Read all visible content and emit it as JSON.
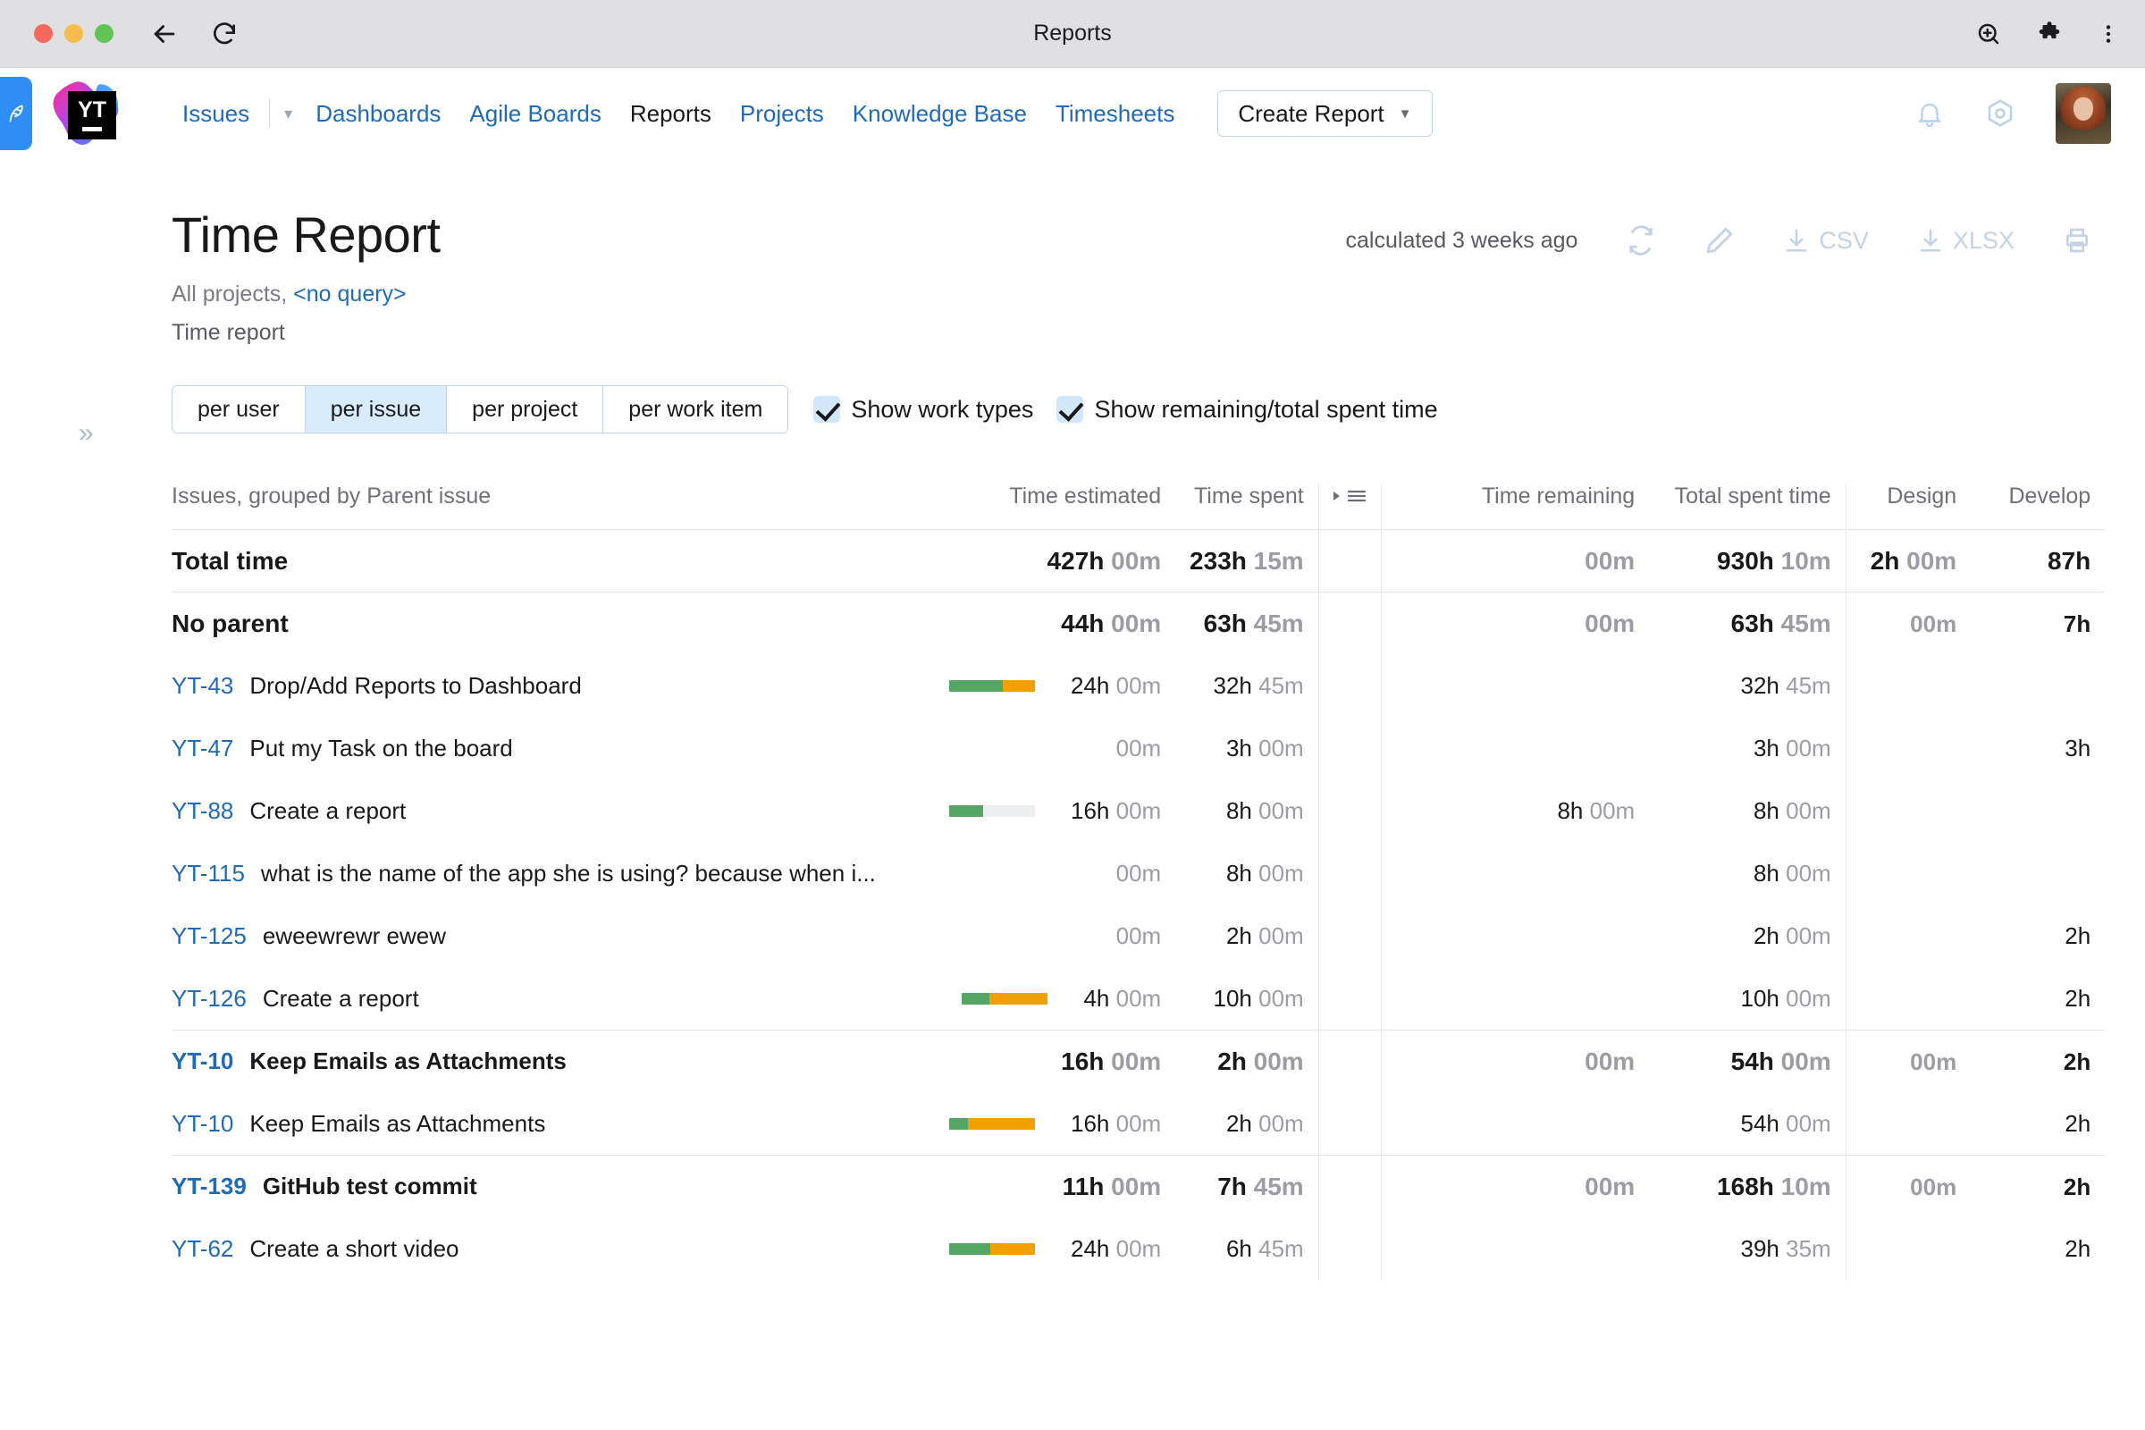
{
  "browser": {
    "tab_title": "Reports",
    "icons": [
      "back-arrow-icon",
      "reload-icon",
      "zoom-icon",
      "extensions-icon",
      "browser-menu-icon"
    ]
  },
  "app_nav": {
    "logo": "youtrack-logo",
    "badge_text": "YT",
    "links": [
      {
        "label": "Issues",
        "active": false,
        "has_chevron": true
      },
      {
        "label": "Dashboards",
        "active": false
      },
      {
        "label": "Agile Boards",
        "active": false
      },
      {
        "label": "Reports",
        "active": true
      },
      {
        "label": "Projects",
        "active": false
      },
      {
        "label": "Knowledge Base",
        "active": false
      },
      {
        "label": "Timesheets",
        "active": false
      }
    ],
    "create_report_label": "Create Report",
    "right_icons": [
      "bell-icon",
      "settings-hex-icon",
      "avatar"
    ]
  },
  "header": {
    "title": "Time Report",
    "subtitle_prefix": "All projects,",
    "subtitle_query": "<no query>",
    "report_type": "Time report",
    "calculated": "calculated 3 weeks ago",
    "actions": [
      {
        "name": "refresh",
        "label": ""
      },
      {
        "name": "edit",
        "label": ""
      },
      {
        "name": "csv",
        "label": "CSV"
      },
      {
        "name": "xlsx",
        "label": "XLSX"
      },
      {
        "name": "print",
        "label": ""
      }
    ]
  },
  "controls": {
    "segments": [
      {
        "label": "per user",
        "active": false
      },
      {
        "label": "per issue",
        "active": true
      },
      {
        "label": "per project",
        "active": false
      },
      {
        "label": "per work item",
        "active": false
      }
    ],
    "checkboxes": [
      {
        "label": "Show work types",
        "checked": true
      },
      {
        "label": "Show remaining/total spent time",
        "checked": true
      }
    ]
  },
  "table": {
    "columns": [
      "Issues, grouped by Parent issue",
      "Time estimated",
      "Time spent",
      "sort-icon",
      "Time remaining",
      "Total spent time",
      "Design",
      "Develop"
    ],
    "rows": [
      {
        "kind": "total",
        "label": "Total time",
        "estimated_h": "427h",
        "estimated_m": "00m",
        "spent_h": "233h",
        "spent_m": "15m",
        "remaining_h": "",
        "remaining_m": "00m",
        "total_h": "930h",
        "total_m": "10m",
        "design_h": "2h",
        "design_m": "00m",
        "develop_h": "87h"
      },
      {
        "kind": "group",
        "label": "No parent",
        "estimated_h": "44h",
        "estimated_m": "00m",
        "spent_h": "63h",
        "spent_m": "45m",
        "remaining_h": "",
        "remaining_m": "00m",
        "total_h": "63h",
        "total_m": "45m",
        "design_h": "",
        "design_m": "00m",
        "develop_h": "7h"
      },
      {
        "kind": "issue",
        "id": "YT-43",
        "summary": "Drop/Add Reports to Dashboard",
        "bar": {
          "green": 62,
          "orange": 38,
          "empty": 0
        },
        "estimated_h": "24h",
        "estimated_m": "00m",
        "spent_h": "32h",
        "spent_m": "45m",
        "remaining_h": "",
        "remaining_m": "",
        "total_h": "32h",
        "total_m": "45m",
        "design_h": "",
        "design_m": "",
        "develop_h": ""
      },
      {
        "kind": "issue",
        "id": "YT-47",
        "summary": "Put my Task on the board",
        "bar": null,
        "estimated_h": "",
        "estimated_m": "00m",
        "spent_h": "3h",
        "spent_m": "00m",
        "remaining_h": "",
        "remaining_m": "",
        "total_h": "3h",
        "total_m": "00m",
        "design_h": "",
        "design_m": "",
        "develop_h": "3h"
      },
      {
        "kind": "issue",
        "id": "YT-88",
        "summary": "Create a report",
        "bar": {
          "green": 40,
          "orange": 0,
          "empty": 60
        },
        "estimated_h": "16h",
        "estimated_m": "00m",
        "spent_h": "8h",
        "spent_m": "00m",
        "remaining_h": "8h",
        "remaining_m": "00m",
        "total_h": "8h",
        "total_m": "00m",
        "design_h": "",
        "design_m": "",
        "develop_h": ""
      },
      {
        "kind": "issue",
        "id": "YT-115",
        "summary": "what is the name of the app she is using? because when i...",
        "bar": null,
        "estimated_h": "",
        "estimated_m": "00m",
        "spent_h": "8h",
        "spent_m": "00m",
        "remaining_h": "",
        "remaining_m": "",
        "total_h": "8h",
        "total_m": "00m",
        "design_h": "",
        "design_m": "",
        "develop_h": ""
      },
      {
        "kind": "issue",
        "id": "YT-125",
        "summary": "eweewrewr ewew",
        "bar": null,
        "estimated_h": "",
        "estimated_m": "00m",
        "spent_h": "2h",
        "spent_m": "00m",
        "remaining_h": "",
        "remaining_m": "",
        "total_h": "2h",
        "total_m": "00m",
        "design_h": "",
        "design_m": "",
        "develop_h": "2h"
      },
      {
        "kind": "issue",
        "id": "YT-126",
        "summary": "Create a report",
        "bar": {
          "green": 32,
          "orange": 68,
          "empty": 0
        },
        "estimated_h": "4h",
        "estimated_m": "00m",
        "spent_h": "10h",
        "spent_m": "00m",
        "remaining_h": "",
        "remaining_m": "",
        "total_h": "10h",
        "total_m": "00m",
        "design_h": "",
        "design_m": "",
        "develop_h": "2h"
      },
      {
        "kind": "group",
        "id": "YT-10",
        "summary": "Keep Emails as Attachments",
        "estimated_h": "16h",
        "estimated_m": "00m",
        "spent_h": "2h",
        "spent_m": "00m",
        "remaining_h": "",
        "remaining_m": "00m",
        "total_h": "54h",
        "total_m": "00m",
        "design_h": "",
        "design_m": "00m",
        "develop_h": "2h"
      },
      {
        "kind": "issue",
        "id": "YT-10",
        "summary": "Keep Emails as Attachments",
        "bar": {
          "green": 22,
          "orange": 78,
          "empty": 0
        },
        "estimated_h": "16h",
        "estimated_m": "00m",
        "spent_h": "2h",
        "spent_m": "00m",
        "remaining_h": "",
        "remaining_m": "",
        "total_h": "54h",
        "total_m": "00m",
        "design_h": "",
        "design_m": "",
        "develop_h": "2h"
      },
      {
        "kind": "group",
        "id": "YT-139",
        "summary": "GitHub test commit",
        "estimated_h": "11h",
        "estimated_m": "00m",
        "spent_h": "7h",
        "spent_m": "45m",
        "remaining_h": "",
        "remaining_m": "00m",
        "total_h": "168h",
        "total_m": "10m",
        "design_h": "",
        "design_m": "00m",
        "develop_h": "2h"
      },
      {
        "kind": "issue",
        "id": "YT-62",
        "summary": "Create a short video",
        "bar": {
          "green": 48,
          "orange": 52,
          "empty": 0
        },
        "estimated_h": "24h",
        "estimated_m": "00m",
        "spent_h": "6h",
        "spent_m": "45m",
        "remaining_h": "",
        "remaining_m": "",
        "total_h": "39h",
        "total_m": "35m",
        "design_h": "",
        "design_m": "",
        "develop_h": "2h"
      }
    ]
  },
  "colors": {
    "link": "#1f6bb8",
    "bar_green": "#55a564",
    "bar_orange": "#f0a000",
    "bar_empty": "#eceef0",
    "seg_active": "#d8ecfd"
  }
}
